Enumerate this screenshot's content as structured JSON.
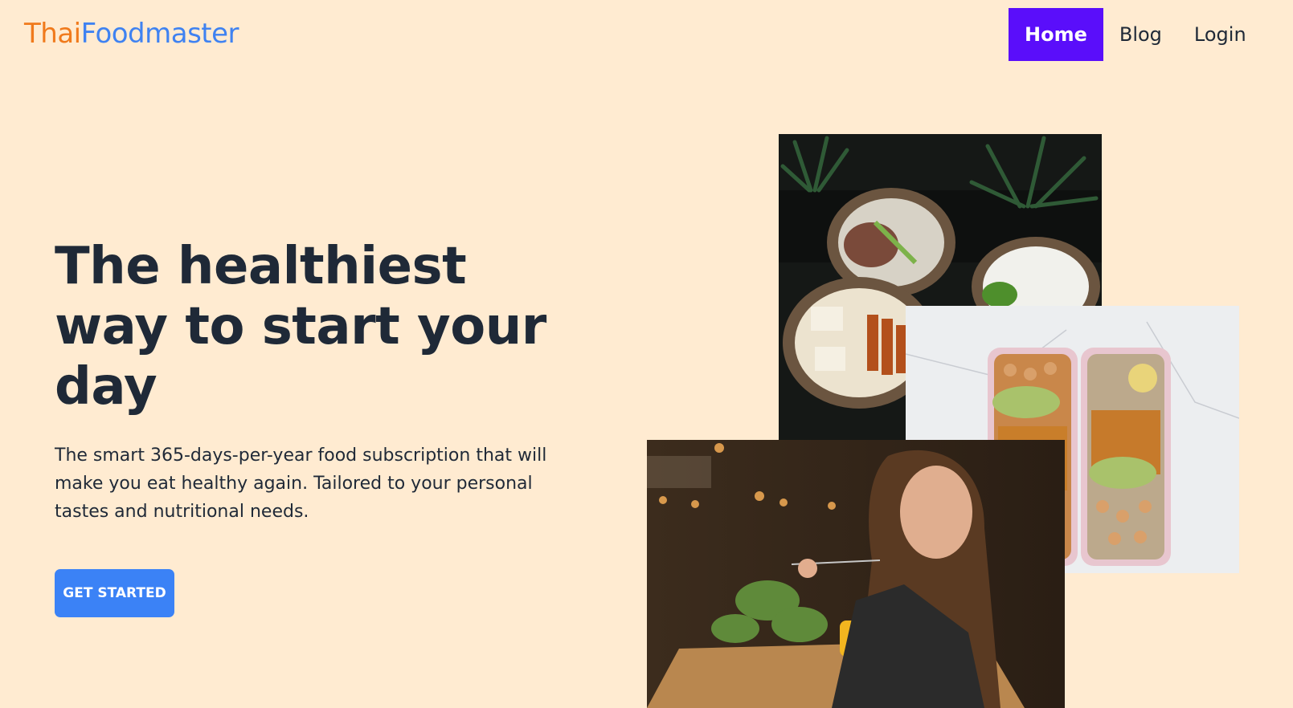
{
  "brand": {
    "part1": "Thai",
    "part2": "Foodmaster"
  },
  "nav": {
    "items": [
      {
        "label": "Home",
        "active": true
      },
      {
        "label": "Blog",
        "active": false
      },
      {
        "label": "Login",
        "active": false
      }
    ]
  },
  "hero": {
    "title": "The healthiest way to start your day",
    "text": "The smart 365-days-per-year food subscription that will make you eat healthy again. Tailored to your personal tastes and nutritional needs.",
    "cta_label": "GET STARTED"
  },
  "colors": {
    "background": "#ffebd1",
    "brand_orange": "#f07a1c",
    "brand_blue": "#3f82f1",
    "nav_active": "#5a0efa",
    "cta": "#3b82f6",
    "text": "#1f2937"
  }
}
